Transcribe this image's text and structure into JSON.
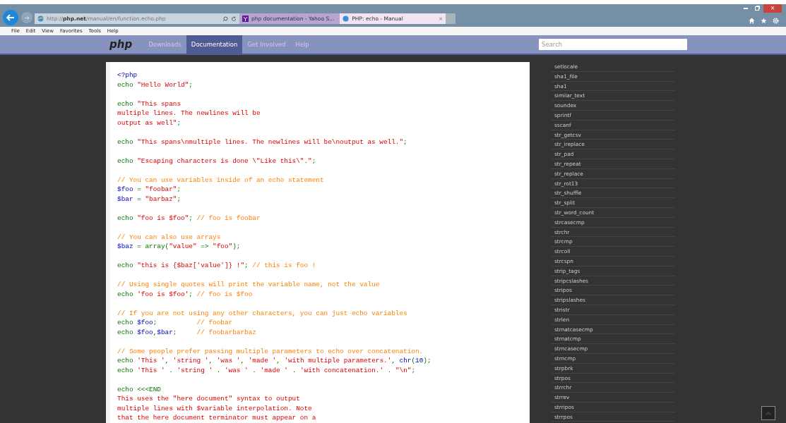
{
  "browser": {
    "address": "http://**php.net**/manual/en/function.echo.php",
    "tabs": [
      {
        "label": "php documentation - Yahoo S...",
        "selected": false
      },
      {
        "label": "PHP: echo - Manual",
        "selected": true
      }
    ],
    "close_glyph": "×",
    "menu": [
      "File",
      "Edit",
      "View",
      "Favorites",
      "Tools",
      "Help"
    ]
  },
  "site_nav": {
    "logo": "php",
    "items": [
      {
        "label": "Downloads",
        "selected": false
      },
      {
        "label": "Documentation",
        "selected": true
      },
      {
        "label": "Get Involved",
        "selected": false
      },
      {
        "label": "Help",
        "selected": false
      }
    ],
    "search": {
      "placeholder": "Search"
    }
  },
  "code": {
    "blocks": [
      [
        [
          {
            "kind": "tag",
            "text": "<?php"
          }
        ],
        [
          {
            "kind": "keyword",
            "text": "echo "
          },
          {
            "kind": "string",
            "text": "\"Hello World\""
          },
          {
            "kind": "keyword",
            "text": ";"
          }
        ]
      ],
      [
        [
          {
            "kind": "keyword",
            "text": "echo "
          },
          {
            "kind": "string",
            "text": "\"This spans"
          }
        ],
        [
          {
            "kind": "string",
            "text": "multiple lines. The newlines will be"
          }
        ],
        [
          {
            "kind": "string",
            "text": "output as well\""
          },
          {
            "kind": "keyword",
            "text": ";"
          }
        ]
      ],
      [
        [
          {
            "kind": "keyword",
            "text": "echo "
          },
          {
            "kind": "string",
            "text": "\"This spans\\nmultiple lines. The newlines will be\\noutput as well.\""
          },
          {
            "kind": "keyword",
            "text": ";"
          }
        ]
      ],
      [
        [
          {
            "kind": "keyword",
            "text": "echo "
          },
          {
            "kind": "string",
            "text": "\"Escaping characters is done \\\"Like this\\\".\""
          },
          {
            "kind": "keyword",
            "text": ";"
          }
        ]
      ],
      [
        [
          {
            "kind": "comment",
            "text": "// You can use variables inside of an echo statement"
          }
        ],
        [
          {
            "kind": "variable",
            "text": "$foo"
          },
          {
            "kind": "keyword",
            "text": " = "
          },
          {
            "kind": "string",
            "text": "\"foobar\""
          },
          {
            "kind": "keyword",
            "text": ";"
          }
        ],
        [
          {
            "kind": "variable",
            "text": "$bar"
          },
          {
            "kind": "keyword",
            "text": " = "
          },
          {
            "kind": "string",
            "text": "\"barbaz\""
          },
          {
            "kind": "keyword",
            "text": ";"
          }
        ]
      ],
      [
        [
          {
            "kind": "keyword",
            "text": "echo "
          },
          {
            "kind": "string",
            "text": "\"foo is $foo\""
          },
          {
            "kind": "keyword",
            "text": "; "
          },
          {
            "kind": "comment",
            "text": "// foo is foobar"
          }
        ]
      ],
      [
        [
          {
            "kind": "comment",
            "text": "// You can also use arrays"
          }
        ],
        [
          {
            "kind": "variable",
            "text": "$baz"
          },
          {
            "kind": "keyword",
            "text": " = array("
          },
          {
            "kind": "string",
            "text": "\"value\""
          },
          {
            "kind": "keyword",
            "text": " => "
          },
          {
            "kind": "string",
            "text": "\"foo\""
          },
          {
            "kind": "keyword",
            "text": ");"
          }
        ]
      ],
      [
        [
          {
            "kind": "keyword",
            "text": "echo "
          },
          {
            "kind": "string",
            "text": "\"this is {$baz['value']} !\""
          },
          {
            "kind": "keyword",
            "text": "; "
          },
          {
            "kind": "comment",
            "text": "// this is foo !"
          }
        ]
      ],
      [
        [
          {
            "kind": "comment",
            "text": "// Using single quotes will print the variable name, not the value"
          }
        ],
        [
          {
            "kind": "keyword",
            "text": "echo "
          },
          {
            "kind": "string",
            "text": "'foo is $foo'"
          },
          {
            "kind": "keyword",
            "text": "; "
          },
          {
            "kind": "comment",
            "text": "// foo is $foo"
          }
        ]
      ],
      [
        [
          {
            "kind": "comment",
            "text": "// If you are not using any other characters, you can just echo variables"
          }
        ],
        [
          {
            "kind": "keyword",
            "text": "echo "
          },
          {
            "kind": "variable",
            "text": "$foo"
          },
          {
            "kind": "keyword",
            "text": ";          "
          },
          {
            "kind": "comment",
            "text": "// foobar"
          }
        ],
        [
          {
            "kind": "keyword",
            "text": "echo "
          },
          {
            "kind": "variable",
            "text": "$foo"
          },
          {
            "kind": "keyword",
            "text": ","
          },
          {
            "kind": "variable",
            "text": "$bar"
          },
          {
            "kind": "keyword",
            "text": ";     "
          },
          {
            "kind": "comment",
            "text": "// foobarbarbaz"
          }
        ]
      ],
      [
        [
          {
            "kind": "comment",
            "text": "// Some people prefer passing multiple parameters to echo over concatenation."
          }
        ],
        [
          {
            "kind": "keyword",
            "text": "echo "
          },
          {
            "kind": "string",
            "text": "'This '"
          },
          {
            "kind": "keyword",
            "text": ", "
          },
          {
            "kind": "string",
            "text": "'string '"
          },
          {
            "kind": "keyword",
            "text": ", "
          },
          {
            "kind": "string",
            "text": "'was '"
          },
          {
            "kind": "keyword",
            "text": ", "
          },
          {
            "kind": "string",
            "text": "'made '"
          },
          {
            "kind": "keyword",
            "text": ", "
          },
          {
            "kind": "string",
            "text": "'with multiple parameters.'"
          },
          {
            "kind": "keyword",
            "text": ", "
          },
          {
            "kind": "variable",
            "text": "chr"
          },
          {
            "kind": "keyword",
            "text": "("
          },
          {
            "kind": "variable",
            "text": "10"
          },
          {
            "kind": "keyword",
            "text": ");"
          }
        ],
        [
          {
            "kind": "keyword",
            "text": "echo "
          },
          {
            "kind": "string",
            "text": "'This '"
          },
          {
            "kind": "keyword",
            "text": " . "
          },
          {
            "kind": "string",
            "text": "'string '"
          },
          {
            "kind": "keyword",
            "text": " . "
          },
          {
            "kind": "string",
            "text": "'was '"
          },
          {
            "kind": "keyword",
            "text": " . "
          },
          {
            "kind": "string",
            "text": "'made '"
          },
          {
            "kind": "keyword",
            "text": " . "
          },
          {
            "kind": "string",
            "text": "'with concatenation.'"
          },
          {
            "kind": "keyword",
            "text": " . "
          },
          {
            "kind": "string",
            "text": "\"\\n\""
          },
          {
            "kind": "keyword",
            "text": ";"
          }
        ]
      ],
      [
        [
          {
            "kind": "keyword",
            "text": "echo <<<END"
          }
        ],
        [
          {
            "kind": "string",
            "text": "This uses the \"here document\" syntax to output"
          }
        ],
        [
          {
            "kind": "string",
            "text": "multiple lines with $variable interpolation. Note"
          }
        ],
        [
          {
            "kind": "string",
            "text": "that the here document terminator must appear on a"
          }
        ]
      ]
    ]
  },
  "function_list": [
    "setlocale",
    "sha1_file",
    "sha1",
    "similar_text",
    "soundex",
    "sprintf",
    "sscanf",
    "str_getcsv",
    "str_ireplace",
    "str_pad",
    "str_repeat",
    "str_replace",
    "str_rot13",
    "str_shuffle",
    "str_split",
    "str_word_count",
    "strcasecmp",
    "strchr",
    "strcmp",
    "strcoll",
    "strcspn",
    "strip_tags",
    "stripcslashes",
    "stripos",
    "stripslashes",
    "stristr",
    "strlen",
    "strnatcasecmp",
    "strnatcmp",
    "strncasecmp",
    "strncmp",
    "strpbrk",
    "strpos",
    "strrchr",
    "strrev",
    "strripos",
    "strrpos"
  ]
}
